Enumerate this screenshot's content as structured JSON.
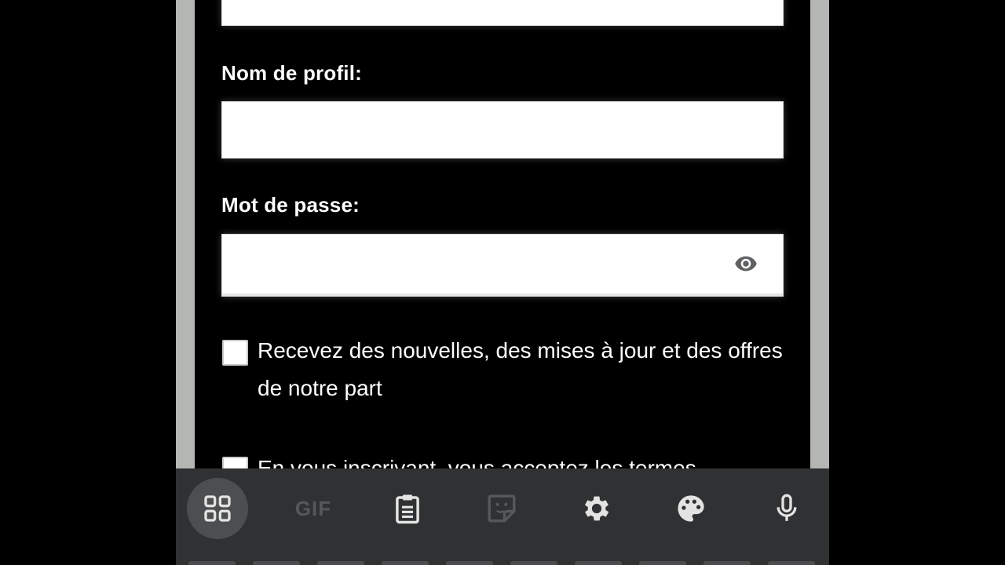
{
  "form": {
    "profile_label": "Nom de profil:",
    "password_label": "Mot de passe:",
    "newsletter_text": "Recevez des nouvelles, des mises à jour et des offres de notre part",
    "terms_text": "En vous inscrivant, vous acceptez les termes"
  },
  "toolbar": {
    "buttons": [
      {
        "name": "apps-grid-icon",
        "active": true
      },
      {
        "name": "gif-button",
        "label": "GIF"
      },
      {
        "name": "clipboard-icon"
      },
      {
        "name": "sticker-icon"
      },
      {
        "name": "gear-icon"
      },
      {
        "name": "palette-icon"
      },
      {
        "name": "microphone-icon"
      }
    ]
  },
  "colors": {
    "toolbar_bg": "#2f3132",
    "icon": "#e3e3e3",
    "icon_dim": "#55585a",
    "panel_bg": "#000000",
    "phone_frame": "#b4b6b3"
  }
}
